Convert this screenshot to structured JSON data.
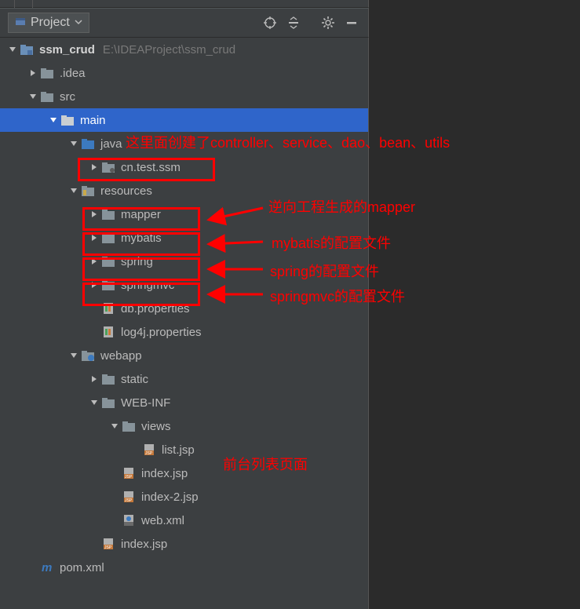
{
  "toolbar": {
    "project_label": "Project"
  },
  "tree": {
    "root_name": "ssm_crud",
    "root_path": "E:\\IDEAProject\\ssm_crud",
    "idea": ".idea",
    "src": "src",
    "main": "main",
    "java": "java",
    "pkg": "cn.test.ssm",
    "resources": "resources",
    "mapper": "mapper",
    "mybatis": "mybatis",
    "spring": "spring",
    "springmvc": "springmvc",
    "dbprops": "db.properties",
    "log4jprops": "log4j.properties",
    "webapp": "webapp",
    "static": "static",
    "webinf": "WEB-INF",
    "views": "views",
    "listjsp": "list.jsp",
    "indexjsp_inner": "index.jsp",
    "index2jsp": "index-2.jsp",
    "webxml": "web.xml",
    "indexjsp_outer": "index.jsp",
    "pom": "pom.xml"
  },
  "annot": {
    "a1": "这里面创建了controller、service、dao、bean、utils",
    "a2": "逆向工程生成的mapper",
    "a3": "mybatis的配置文件",
    "a4": "spring的配置文件",
    "a5": "springmvc的配置文件",
    "a6": "前台列表页面"
  }
}
